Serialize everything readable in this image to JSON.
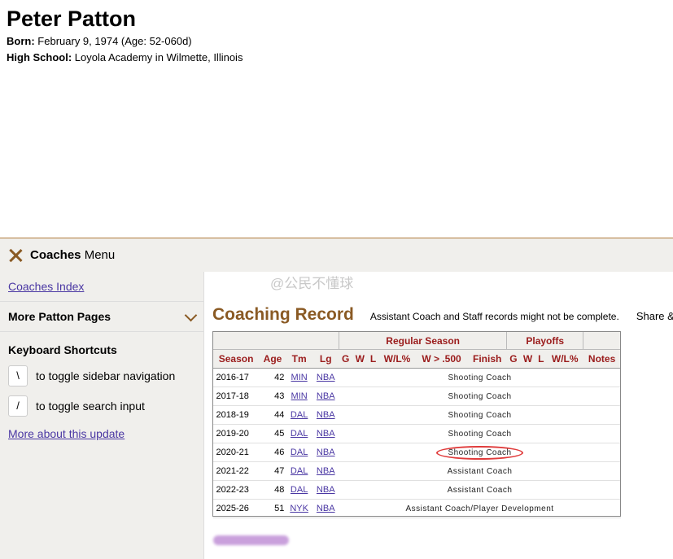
{
  "player": {
    "name": "Peter Patton",
    "born_label": "Born:",
    "born_value": "February 9, 1974 (Age: 52-060d)",
    "hs_label": "High School:",
    "hs_value": "Loyola Academy in Wilmette, Illinois"
  },
  "menu": {
    "section": "Coaches",
    "suffix": "Menu"
  },
  "sidebar": {
    "index_link": "Coaches Index",
    "more_pages": "More Patton Pages",
    "shortcuts_title": "Keyboard Shortcuts",
    "shortcuts": [
      {
        "key": "\\",
        "desc": "to toggle sidebar navigation"
      },
      {
        "key": "/",
        "desc": "to toggle search input"
      }
    ],
    "more_about": "More about this update"
  },
  "record": {
    "title": "Coaching Record",
    "note": "Assistant Coach and Staff records might not be complete.",
    "share": "Share &",
    "group_headers": {
      "regular": "Regular Season",
      "playoffs": "Playoffs"
    },
    "columns": [
      "Season",
      "Age",
      "Tm",
      "Lg",
      "G",
      "W",
      "L",
      "W/L%",
      "W > .500",
      "Finish",
      "G",
      "W",
      "L",
      "W/L%",
      "Notes"
    ],
    "rows": [
      {
        "season": "2016-17",
        "age": "42",
        "tm": "MIN",
        "lg": "NBA",
        "desc": "Shooting Coach"
      },
      {
        "season": "2017-18",
        "age": "43",
        "tm": "MIN",
        "lg": "NBA",
        "desc": "Shooting Coach"
      },
      {
        "season": "2018-19",
        "age": "44",
        "tm": "DAL",
        "lg": "NBA",
        "desc": "Shooting Coach"
      },
      {
        "season": "2019-20",
        "age": "45",
        "tm": "DAL",
        "lg": "NBA",
        "desc": "Shooting Coach"
      },
      {
        "season": "2020-21",
        "age": "46",
        "tm": "DAL",
        "lg": "NBA",
        "desc": "Shooting Coach"
      },
      {
        "season": "2021-22",
        "age": "47",
        "tm": "DAL",
        "lg": "NBA",
        "desc": "Assistant Coach"
      },
      {
        "season": "2022-23",
        "age": "48",
        "tm": "DAL",
        "lg": "NBA",
        "desc": "Assistant Coach"
      },
      {
        "season": "2025-26",
        "age": "51",
        "tm": "NYK",
        "lg": "NBA",
        "desc": "Assistant Coach/Player Development"
      }
    ]
  },
  "watermark": "@公民不懂球",
  "colors": {
    "accent": "#8a5a24",
    "header_red": "#9a1b1b",
    "highlight_circle": "#e03b3b"
  }
}
